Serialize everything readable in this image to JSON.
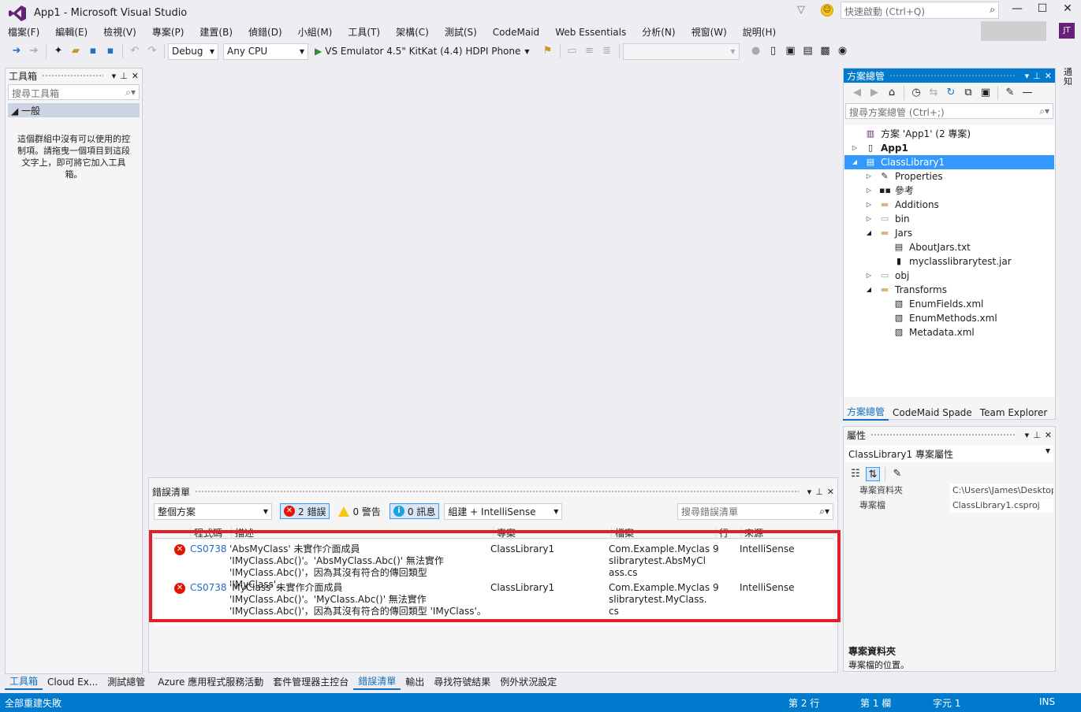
{
  "window": {
    "title": "App1 - Microsoft Visual Studio",
    "quick_launch_placeholder": "快速啟動 (Ctrl+Q)",
    "avatar_initials": "JT",
    "minimize": "—",
    "maximize": "☐",
    "close": "✕"
  },
  "menu": [
    "檔案(F)",
    "編輯(E)",
    "檢視(V)",
    "專案(P)",
    "建置(B)",
    "偵錯(D)",
    "小組(M)",
    "工具(T)",
    "架構(C)",
    "測試(S)",
    "CodeMaid",
    "Web Essentials",
    "分析(N)",
    "視窗(W)",
    "說明(H)"
  ],
  "toolbar": {
    "config": "Debug",
    "platform": "Any CPU",
    "run_target": "VS Emulator 4.5\" KitKat (4.4) HDPI Phone"
  },
  "toolbox": {
    "title": "工具箱",
    "search_placeholder": "搜尋工具箱",
    "group": "◢ 一般",
    "empty_text": "這個群組中沒有可以使用的控制項。請拖曳一個項目到這段文字上，即可將它加入工具箱。"
  },
  "error_list": {
    "title": "錯誤清單",
    "scope": "整個方案",
    "errors_label": "2 錯誤",
    "warnings_label": "0 警告",
    "messages_label": "0 訊息",
    "build_filter": "組建 + IntelliSense",
    "search_placeholder": "搜尋錯誤清單",
    "columns": [
      "程式碼",
      "描述",
      "專案",
      "檔案",
      "行",
      "來源"
    ],
    "rows": [
      {
        "code": "CS0738",
        "description": "'AbsMyClass' 未實作介面成員 'IMyClass.Abc()'。'AbsMyClass.Abc()' 無法實作 'IMyClass.Abc()'，因為其沒有符合的傳回類型 'IMyClass'。",
        "project": "ClassLibrary1",
        "file": "Com.Example.Myclasslibrarytest.AbsMyClass.cs",
        "line": "9",
        "source": "IntelliSense"
      },
      {
        "code": "CS0738",
        "description": "'MyClass' 未實作介面成員 'IMyClass.Abc()'。'MyClass.Abc()' 無法實作 'IMyClass.Abc()'，因為其沒有符合的傳回類型 'IMyClass'。",
        "project": "ClassLibrary1",
        "file": "Com.Example.Myclasslibrarytest.MyClass.cs",
        "line": "9",
        "source": "IntelliSense"
      }
    ]
  },
  "bottom_tabs": [
    "工具箱",
    "Cloud Ex...",
    "測試總管",
    "Azure 應用程式服務活動",
    "套件管理器主控台",
    "錯誤清單",
    "輸出",
    "尋找符號結果",
    "例外狀況設定"
  ],
  "solution_explorer": {
    "title": "方案總管",
    "search_placeholder": "搜尋方案總管 (Ctrl+;)",
    "tree": [
      {
        "label": "方案 'App1' (2 專案)",
        "level": 0,
        "expander": "",
        "icon": "solution-icon"
      },
      {
        "label": "App1",
        "level": 0,
        "expander": "▷",
        "icon": "phone-project-icon",
        "bold": true
      },
      {
        "label": "ClassLibrary1",
        "level": 0,
        "expander": "◢",
        "icon": "library-project-icon",
        "selected": true
      },
      {
        "label": "Properties",
        "level": 1,
        "expander": "▷",
        "icon": "wrench-icon"
      },
      {
        "label": "參考",
        "level": 1,
        "expander": "▷",
        "icon": "references-icon"
      },
      {
        "label": "Additions",
        "level": 1,
        "expander": "▷",
        "icon": "folder-icon"
      },
      {
        "label": "bin",
        "level": 1,
        "expander": "▷",
        "icon": "dashed-folder-icon"
      },
      {
        "label": "Jars",
        "level": 1,
        "expander": "◢",
        "icon": "folder-icon"
      },
      {
        "label": "AboutJars.txt",
        "level": 2,
        "expander": "",
        "icon": "text-file-icon"
      },
      {
        "label": "myclasslibrarytest.jar",
        "level": 2,
        "expander": "",
        "icon": "jar-file-icon"
      },
      {
        "label": "obj",
        "level": 1,
        "expander": "▷",
        "icon": "dashed-folder-icon"
      },
      {
        "label": "Transforms",
        "level": 1,
        "expander": "◢",
        "icon": "folder-icon"
      },
      {
        "label": "EnumFields.xml",
        "level": 2,
        "expander": "",
        "icon": "xml-file-icon"
      },
      {
        "label": "EnumMethods.xml",
        "level": 2,
        "expander": "",
        "icon": "xml-file-icon"
      },
      {
        "label": "Metadata.xml",
        "level": 2,
        "expander": "",
        "icon": "xml-file-icon"
      }
    ],
    "tabs": [
      "方案總管",
      "CodeMaid Spade",
      "Team Explorer"
    ]
  },
  "properties": {
    "title": "屬性",
    "object": "ClassLibrary1  專案屬性",
    "rows": [
      {
        "name": "專案資料夾",
        "value": "C:\\Users\\James\\Desktop"
      },
      {
        "name": "專案檔",
        "value": "ClassLibrary1.csproj"
      }
    ],
    "desc_title": "專案資料夾",
    "desc_text": "專案檔的位置。"
  },
  "right_strip": {
    "label": "通知"
  },
  "status": {
    "message": "全部重建失敗",
    "line": "第 2 行",
    "col": "第 1 欄",
    "char": "字元 1",
    "mode": "INS"
  },
  "colors": {
    "accent": "#007acc",
    "error": "#e51400",
    "highlight": "#e0202b"
  }
}
